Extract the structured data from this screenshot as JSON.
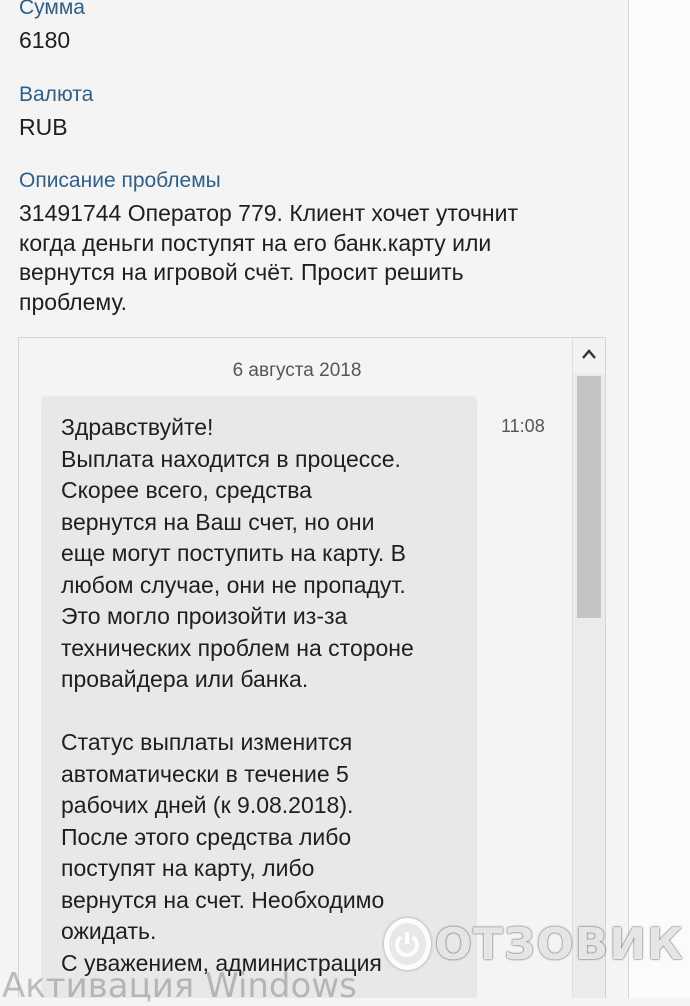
{
  "fields": {
    "amount": {
      "label": "Сумма",
      "value": "6180"
    },
    "currency": {
      "label": "Валюта",
      "value": "RUB"
    },
    "description": {
      "label": "Описание проблемы",
      "value": "31491744 Оператор 779. Клиент хочет уточнит\nкогда деньги поступят на его банк.карту или\nвернутся на игровой счёт. Просит решить\nпроблему."
    }
  },
  "chat": {
    "date": "6 августа 2018",
    "messages": [
      {
        "time": "11:08",
        "text": "Здравствуйте!\nВыплата находится в процессе.\nСкорее всего, средства\nвернутся на Ваш счет, но они\nеще могут поступить на карту. В\nлюбом случае, они не пропадут.\nЭто могло произойти из-за\nтехнических проблем на стороне\nпровайдера или банка.\n\nСтатус выплаты изменится\nавтоматически в течение 5\nрабочих дней (к 9.08.2018).\nПосле этого средства либо\nпоступят на карту, либо\nвернутся на счет. Необходимо\nожидать.\nС уважением, администрация"
      }
    ]
  },
  "icons": {
    "scroll_up": "chevron-up-icon",
    "logo": "power-icon"
  },
  "watermarks": {
    "logo_text": "ОТЗОВИК",
    "activation": "Активация Windows"
  },
  "colors": {
    "label": "#2f5f86",
    "bubble": "#e8e8e8",
    "background": "#f4f4f4"
  }
}
